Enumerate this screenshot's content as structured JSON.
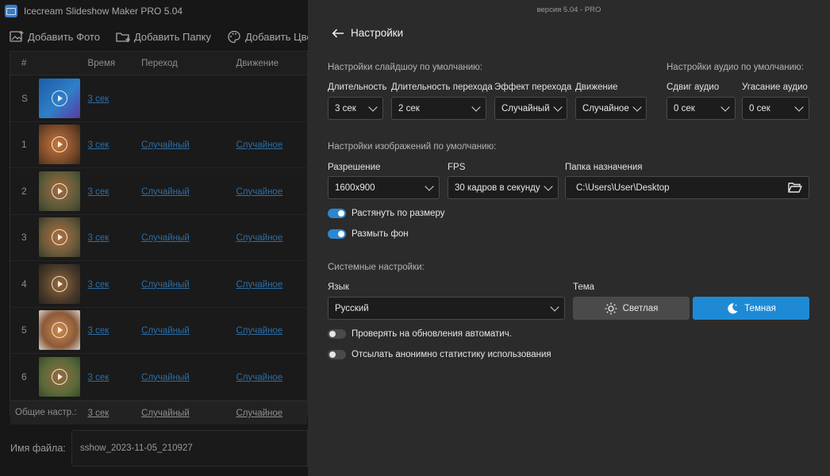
{
  "app": {
    "title": "Icecream Slideshow Maker PRO 5.04"
  },
  "toolbar": {
    "add_photo": "Добавить Фото",
    "add_folder": "Добавить Папку",
    "add_color": "Добавить Цвет"
  },
  "table": {
    "headers": {
      "num": "#",
      "time": "Время",
      "transition": "Переход",
      "motion": "Движение"
    },
    "rows": [
      {
        "num": "S",
        "time": "3 сек",
        "transition": "",
        "motion": ""
      },
      {
        "num": "1",
        "time": "3 сек",
        "transition": "Случайный",
        "motion": "Случайное"
      },
      {
        "num": "2",
        "time": "3 сек",
        "transition": "Случайный",
        "motion": "Случайное"
      },
      {
        "num": "3",
        "time": "3 сек",
        "transition": "Случайный",
        "motion": "Случайное"
      },
      {
        "num": "4",
        "time": "3 сек",
        "transition": "Случайный",
        "motion": "Случайное"
      },
      {
        "num": "5",
        "time": "3 сек",
        "transition": "Случайный",
        "motion": "Случайное"
      },
      {
        "num": "6",
        "time": "3 сек",
        "transition": "Случайный",
        "motion": "Случайное"
      }
    ],
    "footer": {
      "label": "Общие настр.:",
      "time": "3 сек",
      "transition": "Случайный",
      "motion": "Случайное"
    }
  },
  "file": {
    "label": "Имя файла:",
    "value": "sshow_2023-11-05_210927"
  },
  "settings": {
    "version": "версия 5.04 - PRO",
    "title": "Настройки",
    "slideshow": {
      "section": "Настройки слайдшоу по умолчанию:",
      "duration_label": "Длительность",
      "duration_value": "3 сек",
      "transition_duration_label": "Длительность перехода",
      "transition_duration_value": "2 сек",
      "transition_effect_label": "Эффект перехода",
      "transition_effect_value": "Случайный",
      "motion_label": "Движение",
      "motion_value": "Случайное"
    },
    "audio": {
      "section": "Настройки аудио по умолчанию:",
      "shift_label": "Сдвиг аудио",
      "shift_value": "0 сек",
      "fade_label": "Угасание аудио",
      "fade_value": "0 сек"
    },
    "images": {
      "section": "Настройки изображений по умолчанию:",
      "resolution_label": "Разрешение",
      "resolution_value": "1600x900",
      "fps_label": "FPS",
      "fps_value": "30 кадров в секунду",
      "folder_label": "Папка назначения",
      "folder_value": "C:\\Users\\User\\Desktop",
      "stretch_label": "Растянуть по размеру",
      "stretch_on": true,
      "blur_label": "Размыть фон",
      "blur_on": true
    },
    "system": {
      "section": "Системные настройки:",
      "language_label": "Язык",
      "language_value": "Русский",
      "theme_label": "Тема",
      "theme_light": "Светлая",
      "theme_dark": "Темная",
      "theme_selected": "dark",
      "auto_update_label": "Проверять на обновления автоматич.",
      "auto_update_on": false,
      "stats_label": "Отсылать анонимно статистику использования",
      "stats_on": false
    }
  },
  "colors": {
    "accent": "#1e8ad6",
    "toggle_on": "#2b87d1",
    "link": "#2d6ea6",
    "panel_bg": "#2b2b2b"
  }
}
